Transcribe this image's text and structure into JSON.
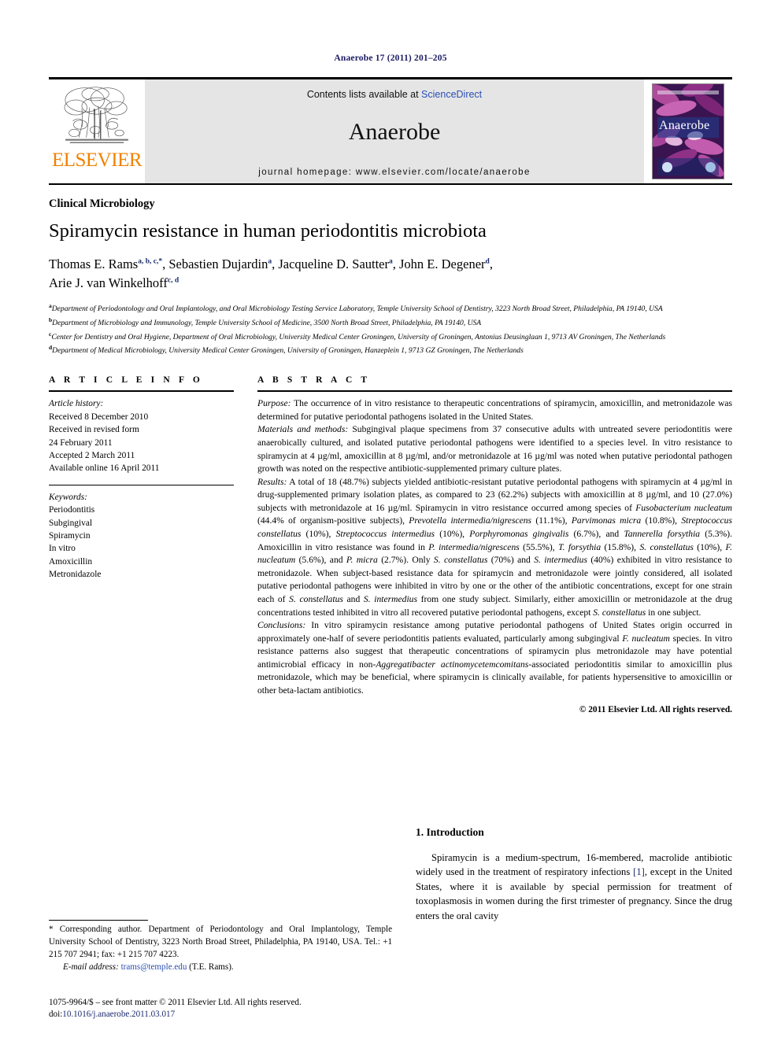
{
  "running_head": "Anaerobe 17 (2011) 201–205",
  "masthead": {
    "publisher_name": "ELSEVIER",
    "contents_prefix": "Contents lists available at ",
    "contents_link": "ScienceDirect",
    "journal_title": "Anaerobe",
    "homepage_line": "journal homepage: www.elsevier.com/locate/anaerobe",
    "cover_title": "Anaerobe"
  },
  "article": {
    "section_label": "Clinical Microbiology",
    "title": "Spiramycin resistance in human periodontitis microbiota",
    "authors": [
      {
        "name": "Thomas E. Rams",
        "marks": "a, b, c,*",
        "sep": ", "
      },
      {
        "name": "Sebastien Dujardin",
        "marks": "a",
        "sep": ", "
      },
      {
        "name": "Jacqueline D. Sautter",
        "marks": "a",
        "sep": ", "
      },
      {
        "name": "John E. Degener",
        "marks": "d",
        "sep": ","
      },
      {
        "name": "Arie J. van Winkelhoff",
        "marks": "c, d",
        "sep": ""
      }
    ],
    "affiliations": [
      {
        "mark": "a",
        "text": "Department of Periodontology and Oral Implantology, and Oral Microbiology Testing Service Laboratory, Temple University School of Dentistry, 3223 North Broad Street, Philadelphia, PA 19140, USA"
      },
      {
        "mark": "b",
        "text": "Department of Microbiology and Immunology, Temple University School of Medicine, 3500 North Broad Street, Philadelphia, PA 19140, USA"
      },
      {
        "mark": "c",
        "text": "Center for Dentistry and Oral Hygiene, Department of Oral Microbiology, University Medical Center Groningen, University of Groningen, Antonius Deusinglaan 1, 9713 AV Groningen, The Netherlands"
      },
      {
        "mark": "d",
        "text": "Department of Medical Microbiology, University Medical Center Groningen, University of Groningen, Hanzeplein 1, 9713 GZ Groningen, The Netherlands"
      }
    ]
  },
  "article_info": {
    "heading": "A R T I C L E  I N F O",
    "history_label": "Article history:",
    "history": [
      "Received 8 December 2010",
      "Received in revised form",
      "24 February 2011",
      "Accepted 2 March 2011",
      "Available online 16 April 2011"
    ],
    "keywords_label": "Keywords:",
    "keywords": [
      "Periodontitis",
      "Subgingival",
      "Spiramycin",
      "In vitro",
      "Amoxicillin",
      "Metronidazole"
    ]
  },
  "abstract": {
    "heading": "A B S T R A C T",
    "purpose_label": "Purpose:",
    "purpose_text": " The occurrence of in vitro resistance to therapeutic concentrations of spiramycin, amoxicillin, and metronidazole was determined for putative periodontal pathogens isolated in the United States.",
    "methods_label": "Materials and methods:",
    "methods_text": " Subgingival plaque specimens from 37 consecutive adults with untreated severe periodontitis were anaerobically cultured, and isolated putative periodontal pathogens were identified to a species level. In vitro resistance to spiramycin at 4 µg/ml, amoxicillin at 8 µg/ml, and/or metronidazole at 16 µg/ml was noted when putative periodontal pathogen growth was noted on the respective antibiotic-supplemented primary culture plates.",
    "results_label": "Results:",
    "results_text_1": " A total of 18 (48.7%) subjects yielded antibiotic-resistant putative periodontal pathogens with spiramycin at 4 µg/ml in drug-supplemented primary isolation plates, as compared to 23 (62.2%) subjects with amoxicillin at 8 µg/ml, and 10 (27.0%) subjects with metronidazole at 16 µg/ml. Spiramycin in vitro resistance occurred among species of ",
    "results_sp_1": "Fusobacterium nucleatum",
    "results_text_2": " (44.4% of organism-positive subjects), ",
    "results_sp_2": "Prevotella intermedia/nigrescens",
    "results_text_3": " (11.1%), ",
    "results_sp_3": "Parvimonas micra",
    "results_text_4": " (10.8%), ",
    "results_sp_4": "Streptococcus constellatus",
    "results_text_5": " (10%), ",
    "results_sp_5": "Streptococcus intermedius",
    "results_text_6": " (10%), ",
    "results_sp_6": "Porphyromonas gingivalis",
    "results_text_7": " (6.7%), and ",
    "results_sp_7": "Tannerella forsythia",
    "results_text_8": " (5.3%). Amoxicillin in vitro resistance was found in ",
    "results_sp_8": "P. intermedia/nigrescens",
    "results_text_9": " (55.5%), ",
    "results_sp_9": "T. forsythia",
    "results_text_10": " (15.8%), ",
    "results_sp_10": "S. constellatus",
    "results_text_11": " (10%), ",
    "results_sp_11": "F. nucleatum",
    "results_text_12": " (5.6%), and ",
    "results_sp_12": "P. micra",
    "results_text_13": " (2.7%). Only ",
    "results_sp_13": "S. constellatus",
    "results_text_14": " (70%) and ",
    "results_sp_14": "S. intermedius",
    "results_text_15": " (40%) exhibited in vitro resistance to metronidazole. When subject-based resistance data for spiramycin and metronidazole were jointly considered, all isolated putative periodontal pathogens were inhibited in vitro by one or the other of the antibiotic concentrations, except for one strain each of ",
    "results_sp_15": "S. constellatus",
    "results_text_16": " and ",
    "results_sp_16": "S. intermedius",
    "results_text_17": " from one study subject. Similarly, either amoxicillin or metronidazole at the drug concentrations tested inhibited in vitro all recovered putative periodontal pathogens, except ",
    "results_sp_17": "S. constellatus",
    "results_text_18": " in one subject.",
    "conclusions_label": "Conclusions:",
    "conclusions_text_1": " In vitro spiramycin resistance among putative periodontal pathogens of United States origin occurred in approximately one-half of severe periodontitis patients evaluated, particularly among subgingival ",
    "conclusions_sp_1": "F. nucleatum",
    "conclusions_text_2": " species. In vitro resistance patterns also suggest that therapeutic concentrations of spiramycin plus metronidazole may have potential antimicrobial efficacy in non-",
    "conclusions_sp_2": "Aggregatibacter actinomycetemcomitans",
    "conclusions_text_3": "-associated periodontitis similar to amoxicillin plus metronidazole, which may be beneficial, where spiramycin is clinically available, for patients hypersensitive to amoxicillin or other beta-lactam antibiotics.",
    "copyright": "© 2011 Elsevier Ltd. All rights reserved."
  },
  "footer": {
    "corresponding_marker": "*",
    "corresponding_text": " Corresponding author. Department of Periodontology and Oral Implantology, Temple University School of Dentistry, 3223 North Broad Street, Philadelphia, PA 19140, USA. Tel.: +1 215 707 2941; fax: +1 215 707 4223.",
    "email_label": "E-mail address:",
    "email": "trams@temple.edu",
    "email_suffix": " (T.E. Rams).",
    "issn_line": "1075-9964/$ – see front matter © 2011 Elsevier Ltd. All rights reserved.",
    "doi_label": "doi:",
    "doi_value": "10.1016/j.anaerobe.2011.03.017"
  },
  "introduction": {
    "heading": "1. Introduction",
    "text_1": "Spiramycin is a medium-spectrum, 16-membered, macrolide antibiotic widely used in the treatment of respiratory infections ",
    "ref": "[1]",
    "text_2": ", except in the United States, where it is available by special permission for treatment of toxoplasmosis in women during the first trimester of pregnancy. Since the drug enters the oral cavity"
  },
  "colors": {
    "elsevier_orange": "#ef8200",
    "link_blue": "#2b4fb5",
    "heading_navy": "#1b1b63",
    "masthead_gray": "#e5e5e5"
  }
}
